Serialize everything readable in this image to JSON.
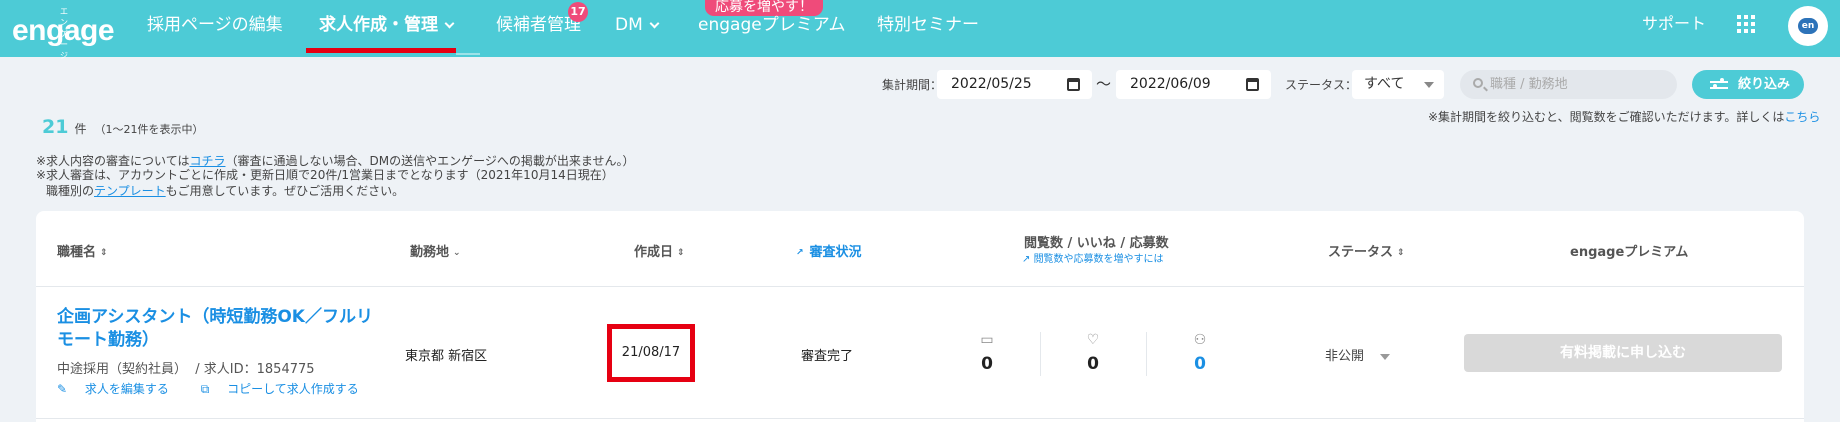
{
  "header": {
    "logo_kana": "エンゲージ",
    "logo": "engage",
    "nav": [
      {
        "label": "採用ページの編集"
      },
      {
        "label": "求人作成・管理"
      },
      {
        "label": "候補者管理",
        "badge": "17"
      },
      {
        "label": "DM"
      },
      {
        "label": "engageプレミアム",
        "badge": "応募を増やす！"
      },
      {
        "label": "特別セミナー"
      }
    ],
    "support": "サポート",
    "avatar": "en"
  },
  "filter": {
    "period_label": "集計期間：",
    "date_from": "2022/05/25",
    "separator": "〜",
    "date_to": "2022/06/09",
    "status_label": "ステータス：",
    "status_value": "すべて",
    "search_placeholder": "職種 / 勤務地",
    "filter_button": "絞り込み",
    "period_note": "※集計期間を絞り込むと、閲覧数をご確認いただけます。詳しくは",
    "period_note_link": "こちら"
  },
  "summary": {
    "count": "21",
    "unit": "件",
    "range": "（1〜21件を表示中）"
  },
  "notes": {
    "line1_prefix": "※求人内容の審査については",
    "line1_link": "コチラ",
    "line1_suffix": "（審査に通過しない場合、DMの送信やエンゲージへの掲載が出来ません。）",
    "line2": "※求人審査は、アカウントごとに作成・更新日順で20件/1営業日までとなります（2021年10月14日現在）",
    "line3_prefix": "職種別の",
    "line3_link": "テンプレート",
    "line3_suffix": "もご用意しています。ぜひご活用ください。"
  },
  "table": {
    "headers": {
      "job": "職種名",
      "location": "勤務地",
      "created": "作成日",
      "review": "審査状況",
      "stats": "閲覧数 / いいね / 応募数",
      "stats_sub": "閲覧数や応募数を増やすには",
      "status": "ステータス",
      "premium": "engageプレミアム"
    },
    "rows": [
      {
        "title": "企画アシスタント（時短勤務OK／フルリモート勤務）",
        "employment": "中途採用（契約社員）",
        "job_id": "/ 求人ID：1854775",
        "edit": "求人を編集する",
        "copy": "コピーして求人作成する",
        "location": "東京都 新宿区",
        "created": "21/08/17",
        "review": "審査完了",
        "views": "0",
        "likes": "0",
        "applications": "0",
        "status": "非公開",
        "premium_button": "有料掲載に申し込む"
      }
    ]
  },
  "colors": {
    "brand": "#4dcbd6",
    "active_underline": "#e60012",
    "link": "#1a8fe3",
    "badge": "#ef4b7a"
  }
}
